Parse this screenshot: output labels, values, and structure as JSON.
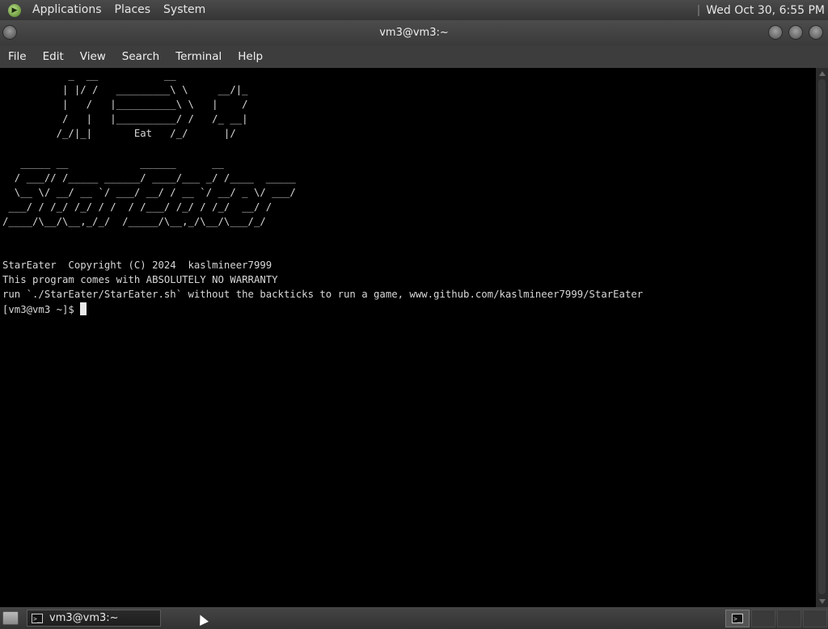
{
  "top_panel": {
    "menus": [
      "Applications",
      "Places",
      "System"
    ],
    "clock": "Wed Oct 30,  6:55 PM"
  },
  "window": {
    "title": "vm3@vm3:~",
    "menubar": [
      "File",
      "Edit",
      "View",
      "Search",
      "Terminal",
      "Help"
    ]
  },
  "terminal": {
    "lines": [
      "           _  __           __",
      "          | |/ /   _________\\ \\     __/|_",
      "          |   /   |__________\\ \\   |    /",
      "          /   |   |__________/ /   /_ __|",
      "         /_/|_|       Eat   /_/      |/",
      "",
      "   _____ __            ______      __",
      "  / ___// /_____ ______/ ____/___ _/ /____  _____",
      "  \\__ \\/ __/ __ `/ ___/ __/ / __ `/ __/ _ \\/ ___/",
      " ___/ / /_/ /_/ / /  / /___/ /_/ / /_/  __/ /",
      "/____/\\__/\\__,_/_/  /_____/\\__,_/\\__/\\___/_/",
      "",
      "",
      "StarEater  Copyright (C) 2024  kaslmineer7999",
      "This program comes with ABSOLUTELY NO WARRANTY",
      "run `./StarEater/StarEater.sh` without the backticks to run a game, www.github.com/kaslmineer7999/StarEater"
    ],
    "prompt": "[vm3@vm3 ~]$ "
  },
  "taskbar": {
    "task_label": "vm3@vm3:~",
    "terminal_icon_glyph": ">_"
  },
  "icons": [
    "gnome-foot-icon",
    "window-menu-icon",
    "minimize-icon",
    "maximize-icon",
    "close-icon",
    "show-desktop-icon",
    "terminal-icon"
  ]
}
